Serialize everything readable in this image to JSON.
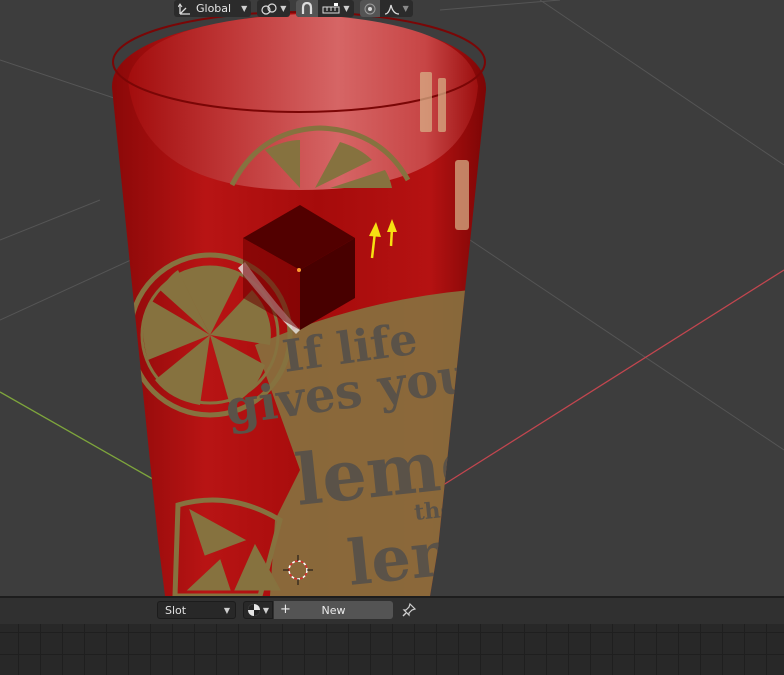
{
  "viewport_header": {
    "orientation": {
      "label": "Global",
      "icon": "transform-orientation-icon"
    },
    "pivot": {
      "icon": "pivot-point-icon"
    },
    "snap": {
      "icon": "snap-magnet-icon",
      "increment_icon": "snap-increment-icon"
    },
    "proportional": {
      "icon": "proportional-editing-icon",
      "falloff_icon": "falloff-curve-icon"
    }
  },
  "scene": {
    "cup_color": "#a80c0c",
    "print_color": "#86723f",
    "text_color": "#5a5248",
    "x_axis_color": "#c2464f",
    "y_axis_color": "#7ea53c",
    "cup_print_lines": [
      "If life",
      "gives you",
      "lemo",
      "the",
      "lem"
    ],
    "arrows_color": "#f6e012"
  },
  "material_toolbar": {
    "slot_label": "Slot",
    "browse_icon": "material-sphere-icon",
    "new_label": "New",
    "new_icon": "plus-icon",
    "pin_icon": "pin-icon"
  }
}
